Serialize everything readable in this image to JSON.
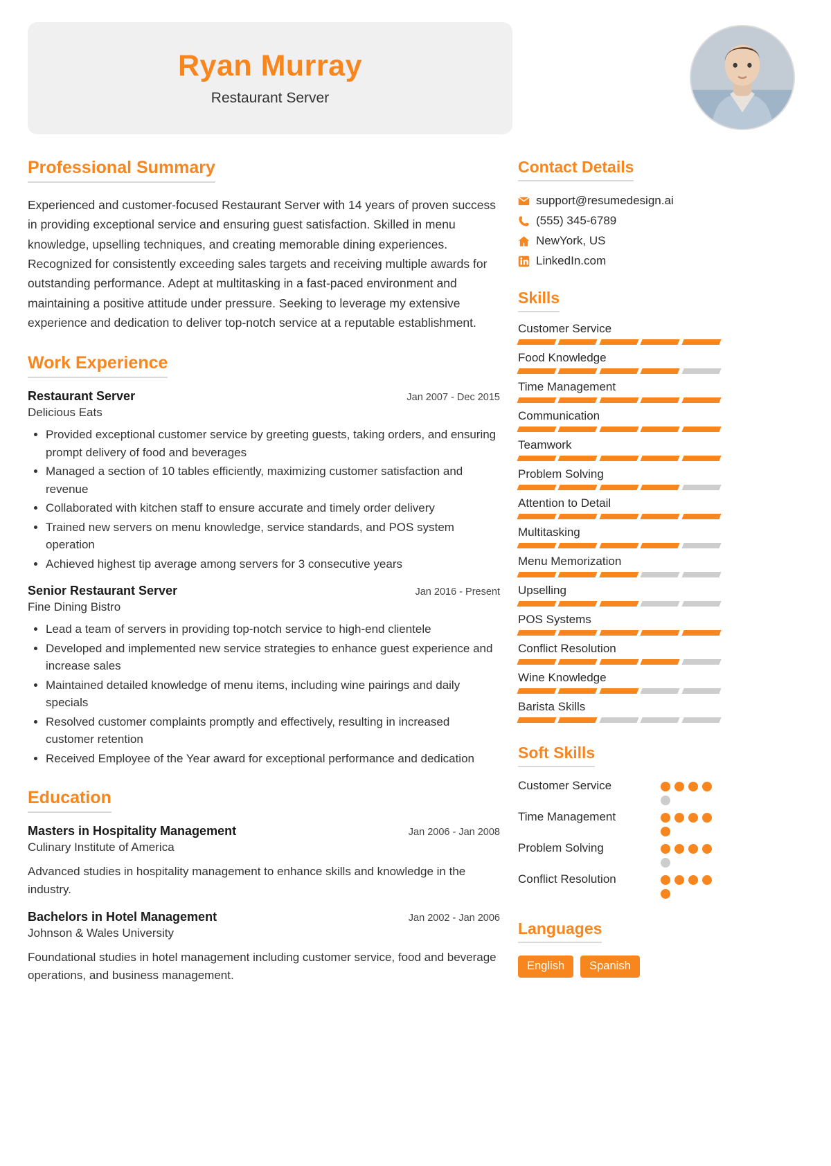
{
  "accent": "#F7861F",
  "muted": "#CDCDCD",
  "header": {
    "name": "Ryan Murray",
    "role": "Restaurant Server",
    "avatar_icon": "profile-photo"
  },
  "left": {
    "summary_section": {
      "title": "Professional Summary",
      "text": "Experienced and customer-focused Restaurant Server with 14 years of proven success in providing exceptional service and ensuring guest satisfaction. Skilled in menu knowledge, upselling techniques, and creating memorable dining experiences. Recognized for consistently exceeding sales targets and receiving multiple awards for outstanding performance. Adept at multitasking in a fast-paced environment and maintaining a positive attitude under pressure. Seeking to leverage my extensive experience and dedication to deliver top-notch service at a reputable establishment."
    },
    "work_section": {
      "title": "Work Experience",
      "jobs": [
        {
          "title": "Restaurant Server",
          "date": "Jan 2007 - Dec 2015",
          "org": "Delicious Eats",
          "bullets": [
            "Provided exceptional customer service by greeting guests, taking orders, and ensuring prompt delivery of food and beverages",
            "Managed a section of 10 tables efficiently, maximizing customer satisfaction and revenue",
            "Collaborated with kitchen staff to ensure accurate and timely order delivery",
            "Trained new servers on menu knowledge, service standards, and POS system operation",
            "Achieved highest tip average among servers for 3 consecutive years"
          ]
        },
        {
          "title": "Senior Restaurant Server",
          "date": "Jan 2016 - Present",
          "org": "Fine Dining Bistro",
          "bullets": [
            "Lead a team of servers in providing top-notch service to high-end clientele",
            "Developed and implemented new service strategies to enhance guest experience and increase sales",
            "Maintained detailed knowledge of menu items, including wine pairings and daily specials",
            "Resolved customer complaints promptly and effectively, resulting in increased customer retention",
            "Received Employee of the Year award for exceptional performance and dedication"
          ]
        }
      ]
    },
    "education_section": {
      "title": "Education",
      "entries": [
        {
          "title": "Masters in Hospitality Management",
          "date": "Jan 2006 - Jan 2008",
          "org": "Culinary Institute of America",
          "desc": "Advanced studies in hospitality management to enhance skills and knowledge in the industry."
        },
        {
          "title": "Bachelors in Hotel Management",
          "date": "Jan 2002 - Jan 2006",
          "org": "Johnson & Wales University",
          "desc": "Foundational studies in hotel management including customer service, food and beverage operations, and business management."
        }
      ]
    }
  },
  "right": {
    "contact_section": {
      "title": "Contact Details",
      "items": [
        {
          "icon": "envelope-icon",
          "value": "support@resumedesign.ai"
        },
        {
          "icon": "phone-icon",
          "value": "(555) 345-6789"
        },
        {
          "icon": "home-icon",
          "value": "NewYork, US"
        },
        {
          "icon": "linkedin-icon",
          "value": "LinkedIn.com"
        }
      ]
    },
    "skills_section": {
      "title": "Skills",
      "max": 5,
      "items": [
        {
          "name": "Customer Service",
          "level": 5
        },
        {
          "name": "Food Knowledge",
          "level": 4
        },
        {
          "name": "Time Management",
          "level": 5
        },
        {
          "name": "Communication",
          "level": 5
        },
        {
          "name": "Teamwork",
          "level": 5
        },
        {
          "name": "Problem Solving",
          "level": 4
        },
        {
          "name": "Attention to Detail",
          "level": 5
        },
        {
          "name": "Multitasking",
          "level": 4
        },
        {
          "name": "Menu Memorization",
          "level": 3
        },
        {
          "name": "Upselling",
          "level": 3
        },
        {
          "name": "POS Systems",
          "level": 5
        },
        {
          "name": "Conflict Resolution",
          "level": 4
        },
        {
          "name": "Wine Knowledge",
          "level": 3
        },
        {
          "name": "Barista Skills",
          "level": 2
        }
      ]
    },
    "soft_skills_section": {
      "title": "Soft Skills",
      "max": 5,
      "items": [
        {
          "name": "Customer Service",
          "level": 4
        },
        {
          "name": "Time Management",
          "level": 5
        },
        {
          "name": "Problem Solving",
          "level": 4
        },
        {
          "name": "Conflict Resolution",
          "level": 5
        }
      ]
    },
    "languages_section": {
      "title": "Languages",
      "items": [
        "English",
        "Spanish"
      ]
    }
  }
}
